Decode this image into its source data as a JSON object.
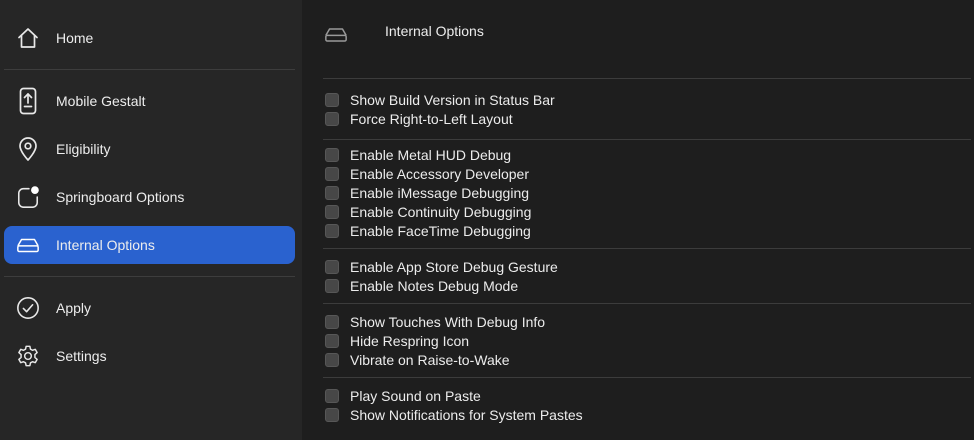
{
  "sidebar": {
    "items": [
      {
        "label": "Home",
        "icon": "home-icon"
      },
      {
        "label": "Mobile Gestalt",
        "icon": "phone-icon"
      },
      {
        "label": "Eligibility",
        "icon": "location-pin-icon"
      },
      {
        "label": "Springboard Options",
        "icon": "app-badge-icon"
      },
      {
        "label": "Internal Options",
        "icon": "drive-icon",
        "active": true
      },
      {
        "label": "Apply",
        "icon": "checkmark-circle-icon"
      },
      {
        "label": "Settings",
        "icon": "gear-icon"
      }
    ]
  },
  "main": {
    "title": "Internal Options",
    "title_icon": "drive-icon",
    "groups": [
      {
        "options": [
          {
            "label": "Show Build Version in Status Bar",
            "checked": false
          },
          {
            "label": "Force Right-to-Left Layout",
            "checked": false
          }
        ]
      },
      {
        "options": [
          {
            "label": "Enable Metal HUD Debug",
            "checked": false
          },
          {
            "label": "Enable Accessory Developer",
            "checked": false
          },
          {
            "label": "Enable iMessage Debugging",
            "checked": false
          },
          {
            "label": "Enable Continuity Debugging",
            "checked": false
          },
          {
            "label": "Enable FaceTime Debugging",
            "checked": false
          }
        ]
      },
      {
        "options": [
          {
            "label": "Enable App Store Debug Gesture",
            "checked": false
          },
          {
            "label": "Enable Notes Debug Mode",
            "checked": false
          }
        ]
      },
      {
        "options": [
          {
            "label": "Show Touches With Debug Info",
            "checked": false
          },
          {
            "label": "Hide Respring Icon",
            "checked": false
          },
          {
            "label": "Vibrate on Raise-to-Wake",
            "checked": false
          }
        ]
      },
      {
        "options": [
          {
            "label": "Play Sound on Paste",
            "checked": false
          },
          {
            "label": "Show Notifications for System Pastes",
            "checked": false
          }
        ]
      }
    ]
  },
  "colors": {
    "background": "#1e1e1e",
    "sidebar_background": "#262626",
    "accent": "#2a62cf",
    "text": "#ececec",
    "divider": "#3c3c3c"
  }
}
